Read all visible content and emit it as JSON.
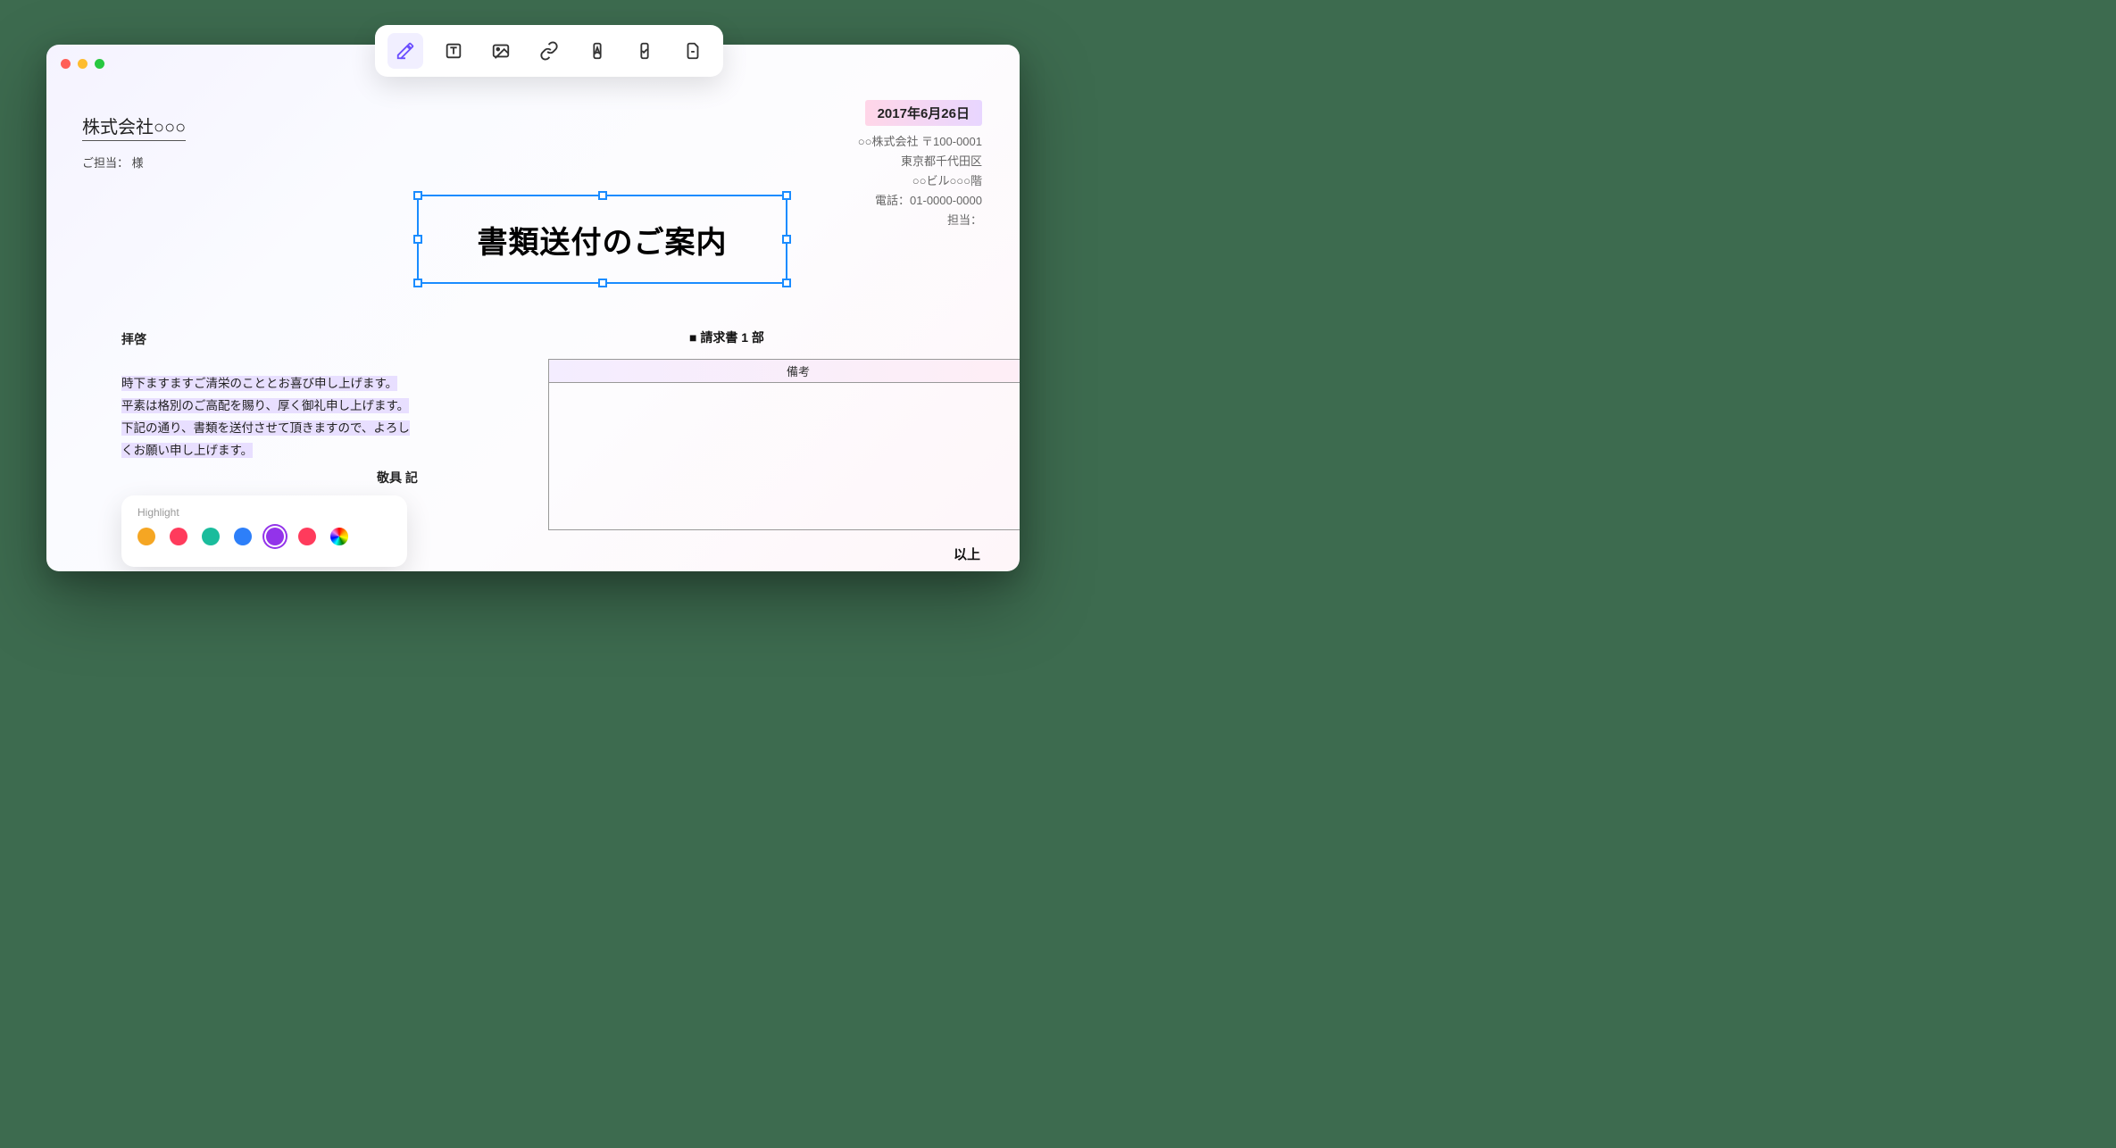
{
  "toolbar": {
    "tools": [
      "pen",
      "text",
      "image",
      "link",
      "font",
      "shape",
      "page"
    ]
  },
  "document": {
    "company_name": "株式会社○○○",
    "contact_label": "ご担当： 様",
    "date": "2017年6月26日",
    "sender": {
      "company": "○○株式会社 〒100-0001",
      "address1": "東京都千代田区",
      "address2": "○○ビル○○○階",
      "phone": "電話：01-0000-0000",
      "person": "担当："
    },
    "title": "書類送付のご案内",
    "greeting": "拝啓",
    "body_line1": "時下ますますご清栄のこととお喜び申し上げます。",
    "body_line2": "平素は格別のご高配を賜り、厚く御礼申し上げます。",
    "body_line3": "下記の通り、書類を送付させて頂きますので、よろし",
    "body_line4": "くお願い申し上げます。",
    "closing": "敬具 記",
    "invoice_label": "■ 請求書 1 部",
    "remarks_header": "備考",
    "end_label": "以上"
  },
  "highlight": {
    "title": "Highlight",
    "colors": [
      "#f5a623",
      "#ff3b5c",
      "#1abc9c",
      "#2d7ff9",
      "#9333ea",
      "#ff3b5c"
    ]
  }
}
